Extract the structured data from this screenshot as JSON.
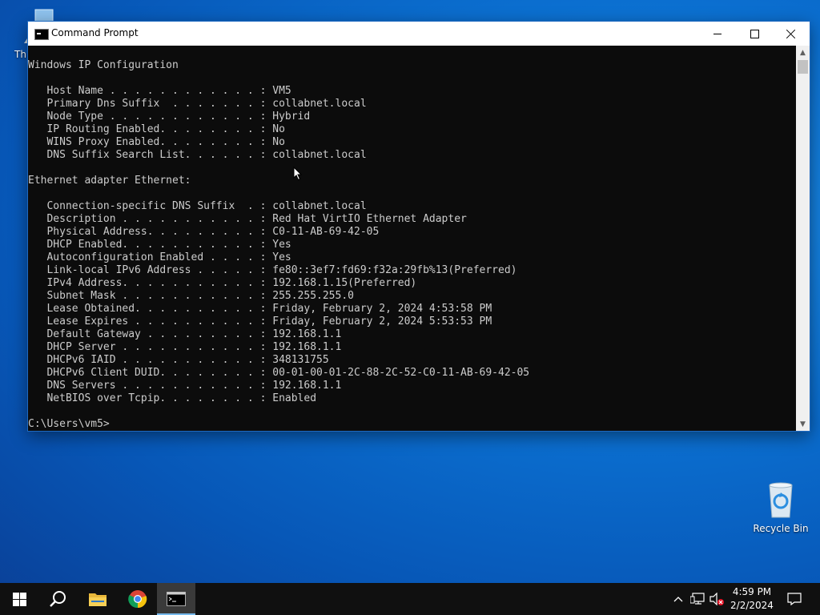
{
  "desktop": {
    "icons": [
      {
        "label": "Th"
      },
      {
        "label": "Recycle Bin"
      }
    ]
  },
  "window": {
    "title": "Command Prompt",
    "controls": {
      "minimize": "minimize",
      "maximize": "maximize",
      "close": "close"
    }
  },
  "console": {
    "lines": [
      "Windows IP Configuration",
      "",
      "   Host Name . . . . . . . . . . . . : VM5",
      "   Primary Dns Suffix  . . . . . . . : collabnet.local",
      "   Node Type . . . . . . . . . . . . : Hybrid",
      "   IP Routing Enabled. . . . . . . . : No",
      "   WINS Proxy Enabled. . . . . . . . : No",
      "   DNS Suffix Search List. . . . . . : collabnet.local",
      "",
      "Ethernet adapter Ethernet:",
      "",
      "   Connection-specific DNS Suffix  . : collabnet.local",
      "   Description . . . . . . . . . . . : Red Hat VirtIO Ethernet Adapter",
      "   Physical Address. . . . . . . . . : C0-11-AB-69-42-05",
      "   DHCP Enabled. . . . . . . . . . . : Yes",
      "   Autoconfiguration Enabled . . . . : Yes",
      "   Link-local IPv6 Address . . . . . : fe80::3ef7:fd69:f32a:29fb%13(Preferred)",
      "   IPv4 Address. . . . . . . . . . . : 192.168.1.15(Preferred)",
      "   Subnet Mask . . . . . . . . . . . : 255.255.255.0",
      "   Lease Obtained. . . . . . . . . . : Friday, February 2, 2024 4:53:58 PM",
      "   Lease Expires . . . . . . . . . . : Friday, February 2, 2024 5:53:53 PM",
      "   Default Gateway . . . . . . . . . : 192.168.1.1",
      "   DHCP Server . . . . . . . . . . . : 192.168.1.1",
      "   DHCPv6 IAID . . . . . . . . . . . : 348131755",
      "   DHCPv6 Client DUID. . . . . . . . : 00-01-00-01-2C-88-2C-52-C0-11-AB-69-42-05",
      "   DNS Servers . . . . . . . . . . . : 192.168.1.1",
      "   NetBIOS over Tcpip. . . . . . . . : Enabled",
      "",
      "C:\\Users\\vm5>"
    ]
  },
  "taskbar": {
    "buttons": [
      "start-icon",
      "search-icon",
      "file-explorer-icon",
      "chrome-icon",
      "command-prompt-icon"
    ],
    "tray_icons": [
      "chevron-up-icon",
      "network-icon",
      "volume-muted-icon"
    ],
    "clock": {
      "time": "4:59 PM",
      "date": "2/2/2024"
    }
  },
  "colors": {
    "console_bg": "#0c0c0c",
    "console_fg": "#cccccc",
    "taskbar_bg": "#101010",
    "desktop_accent": "#0b6fd0"
  }
}
